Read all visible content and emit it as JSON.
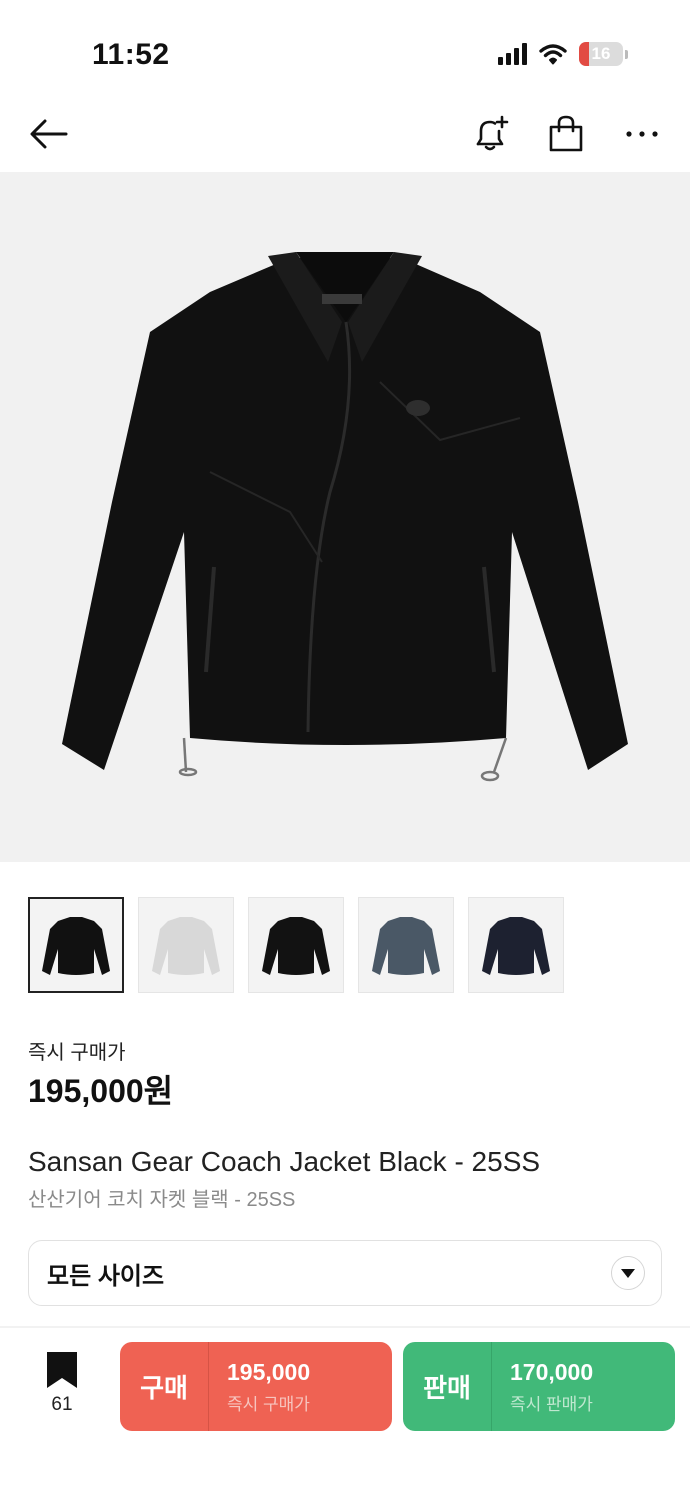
{
  "status_bar": {
    "time": "11:52",
    "battery": "16",
    "icons": [
      "cellular-signal-icon",
      "wifi-icon",
      "battery-icon"
    ]
  },
  "top_nav": {
    "icons": [
      "back-arrow-icon",
      "bell-plus-icon",
      "shopping-bag-icon",
      "more-icon"
    ]
  },
  "product": {
    "image": "black-coach-jacket",
    "thumbnails": [
      "black",
      "light-gray",
      "black",
      "slate-blue",
      "navy"
    ],
    "price_label": "즉시 구매가",
    "price": "195,000원",
    "title_en": "Sansan Gear Coach Jacket Black - 25SS",
    "title_ko": "산산기어 코치 자켓 블랙 - 25SS"
  },
  "size_select": {
    "label": "모든 사이즈"
  },
  "bottom_bar": {
    "bookmark_count": "61",
    "buy": {
      "label": "구매",
      "price": "195,000",
      "sub": "즉시 구매가"
    },
    "sell": {
      "label": "판매",
      "price": "170,000",
      "sub": "즉시 판매가"
    }
  },
  "colors": {
    "buy": "#ef6253",
    "sell": "#41b979",
    "thumbnail_colors": [
      "#111111",
      "#d8d8d8",
      "#121212",
      "#4a5866",
      "#1d2130"
    ]
  }
}
